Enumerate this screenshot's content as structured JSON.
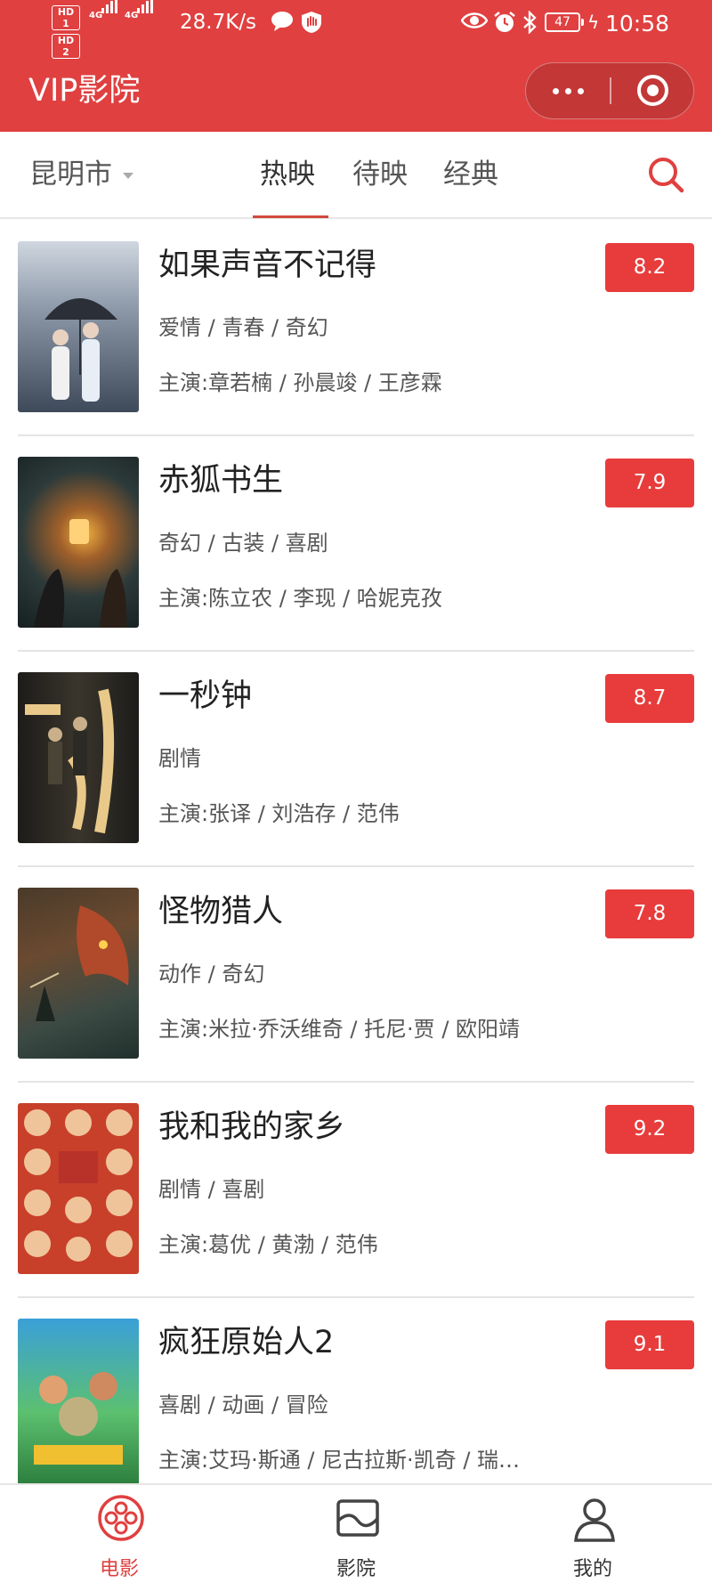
{
  "status_bar": {
    "hd1": "HD 1",
    "hd2": "HD 2",
    "net1": "4G",
    "net2": "4G",
    "speed": "28.7K/s",
    "battery": "47",
    "time": "10:58"
  },
  "header": {
    "title": "VIP影院"
  },
  "filter_bar": {
    "city": "昆明市",
    "tabs": [
      {
        "label": "热映",
        "active": true
      },
      {
        "label": "待映",
        "active": false
      },
      {
        "label": "经典",
        "active": false
      }
    ]
  },
  "movies": [
    {
      "title": "如果声音不记得",
      "genre": "爱情 / 青春 / 奇幻",
      "cast": "主演:章若楠 / 孙晨竣 / 王彦霖",
      "score": "8.2"
    },
    {
      "title": "赤狐书生",
      "genre": "奇幻 / 古装 / 喜剧",
      "cast": "主演:陈立农 / 李现 / 哈妮克孜",
      "score": "7.9"
    },
    {
      "title": "一秒钟",
      "genre": "剧情",
      "cast": "主演:张译 / 刘浩存 / 范伟",
      "score": "8.7"
    },
    {
      "title": "怪物猎人",
      "genre": "动作 / 奇幻",
      "cast": "主演:米拉·乔沃维奇 / 托尼·贾 / 欧阳靖",
      "score": "7.8"
    },
    {
      "title": "我和我的家乡",
      "genre": "剧情 / 喜剧",
      "cast": "主演:葛优 / 黄渤 / 范伟",
      "score": "9.2"
    },
    {
      "title": "疯狂原始人2",
      "genre": "喜剧 / 动画 / 冒险",
      "cast": "主演:艾玛·斯通 / 尼古拉斯·凯奇 / 瑞…",
      "score": "9.1"
    }
  ],
  "bottom_nav": [
    {
      "label": "电影",
      "icon": "film-reel-icon",
      "active": true
    },
    {
      "label": "影院",
      "icon": "cinema-picture-icon",
      "active": false
    },
    {
      "label": "我的",
      "icon": "user-icon",
      "active": false
    }
  ],
  "colors": {
    "brand_red": "#e04040",
    "score_red": "#e83c3c"
  }
}
